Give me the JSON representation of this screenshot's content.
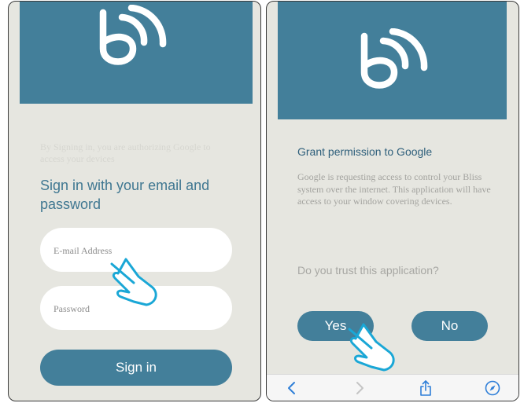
{
  "left_screen": {
    "logo": "bliss-logo-icon",
    "authorization_notice": "By Signing in, you are authorizing Google to access your devices",
    "heading": "Sign in with your email and password",
    "email_placeholder": "E-mail Address",
    "password_placeholder": "Password",
    "signin_label": "Sign in"
  },
  "right_screen": {
    "logo": "bliss-logo-icon",
    "title": "Grant permission to Google",
    "body": "Google is requesting access to control your Bliss system over the internet. This application will have access to your window covering devices.",
    "question": "Do you trust this application?",
    "yes_label": "Yes",
    "no_label": "No",
    "toolbar": {
      "back": "chevron-left-icon",
      "forward": "chevron-right-icon",
      "share": "share-icon",
      "compass": "compass-icon"
    }
  },
  "colors": {
    "brand": "#437f9a",
    "background": "#e6e6e0",
    "hand_outline": "#1aa7d6"
  }
}
